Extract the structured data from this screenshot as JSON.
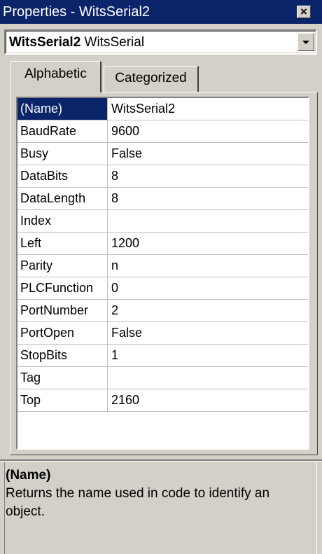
{
  "window": {
    "title": "Properties - WitsSerial2",
    "close_label": "×"
  },
  "object_selector": {
    "object_name": "WitsSerial2",
    "object_type": "WitsSerial"
  },
  "tabs": [
    {
      "label": "Alphabetic",
      "active": true
    },
    {
      "label": "Categorized",
      "active": false
    }
  ],
  "properties": [
    {
      "name": "(Name)",
      "value": "WitsSerial2",
      "selected": true
    },
    {
      "name": "BaudRate",
      "value": "9600"
    },
    {
      "name": "Busy",
      "value": "False"
    },
    {
      "name": "DataBits",
      "value": "8"
    },
    {
      "name": "DataLength",
      "value": "8"
    },
    {
      "name": "Index",
      "value": ""
    },
    {
      "name": "Left",
      "value": "1200"
    },
    {
      "name": "Parity",
      "value": "n"
    },
    {
      "name": "PLCFunction",
      "value": "0"
    },
    {
      "name": "PortNumber",
      "value": "2"
    },
    {
      "name": "PortOpen",
      "value": "False"
    },
    {
      "name": "StopBits",
      "value": "1"
    },
    {
      "name": "Tag",
      "value": ""
    },
    {
      "name": "Top",
      "value": "2160"
    }
  ],
  "description": {
    "title": "(Name)",
    "text": "Returns the name used in code to identify an object."
  },
  "colors": {
    "titlebar": "#0a246a",
    "face": "#d4d0c8",
    "selection": "#0a246a"
  }
}
